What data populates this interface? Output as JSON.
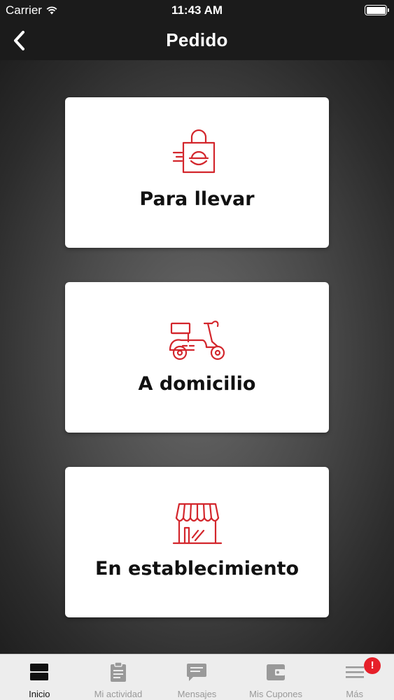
{
  "status_bar": {
    "carrier": "Carrier",
    "time": "11:43 AM",
    "battery_level": 1.0
  },
  "nav": {
    "title": "Pedido",
    "back_icon": "chevron-left-icon"
  },
  "colors": {
    "accent": "#d3262c",
    "bar_background": "#1b1b1b",
    "tab_bar_background": "#ededed",
    "badge": "#e6202a"
  },
  "options": [
    {
      "label": "Para llevar",
      "icon": "takeaway-bag-icon"
    },
    {
      "label": "A domicilio",
      "icon": "delivery-scooter-icon"
    },
    {
      "label": "En establecimiento",
      "icon": "storefront-icon"
    }
  ],
  "tabs": [
    {
      "label": "Inicio",
      "icon": "home-icon",
      "active": true
    },
    {
      "label": "Mi actividad",
      "icon": "clipboard-icon",
      "active": false
    },
    {
      "label": "Mensajes",
      "icon": "message-icon",
      "active": false
    },
    {
      "label": "Mis Cupones",
      "icon": "wallet-icon",
      "active": false
    },
    {
      "label": "Más",
      "icon": "menu-icon",
      "active": false,
      "badge": "!"
    }
  ]
}
